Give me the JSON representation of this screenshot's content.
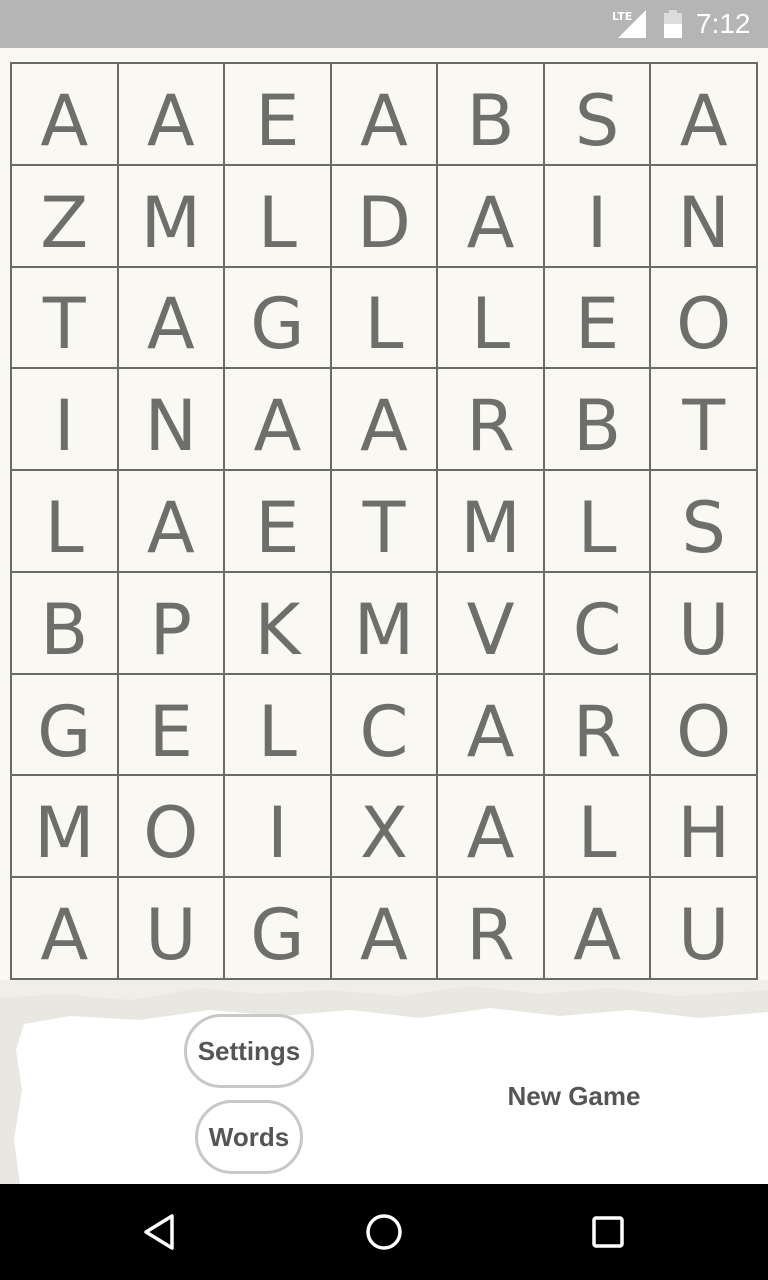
{
  "status_bar": {
    "network": "LTE",
    "time": "7:12",
    "icons": [
      "lte-icon",
      "signal-icon",
      "battery-icon"
    ]
  },
  "grid": {
    "columns": 7,
    "rows": 9,
    "letters": [
      [
        "A",
        "A",
        "E",
        "A",
        "B",
        "S",
        "A"
      ],
      [
        "Z",
        "M",
        "L",
        "D",
        "A",
        "I",
        "N"
      ],
      [
        "T",
        "A",
        "G",
        "L",
        "L",
        "E",
        "O"
      ],
      [
        "I",
        "N",
        "A",
        "A",
        "R",
        "B",
        "T"
      ],
      [
        "L",
        "A",
        "E",
        "T",
        "M",
        "L",
        "S"
      ],
      [
        "B",
        "P",
        "K",
        "M",
        "V",
        "C",
        "U"
      ],
      [
        "G",
        "E",
        "L",
        "C",
        "A",
        "R",
        "O"
      ],
      [
        "M",
        "O",
        "I",
        "X",
        "A",
        "L",
        "H"
      ],
      [
        "A",
        "U",
        "G",
        "A",
        "R",
        "A",
        "U"
      ]
    ]
  },
  "buttons": {
    "settings": "Settings",
    "words": "Words",
    "new_game": "New Game"
  },
  "nav_bar": {
    "icons": [
      "back-icon",
      "home-icon",
      "recents-icon"
    ]
  },
  "colors": {
    "status_bar": "#b5b5b5",
    "grid_line": "#6a6a66",
    "letter": "#6e6e6a",
    "cell_background": "#faf8f2",
    "button_text": "#555555",
    "nav_bar": "#000000"
  }
}
